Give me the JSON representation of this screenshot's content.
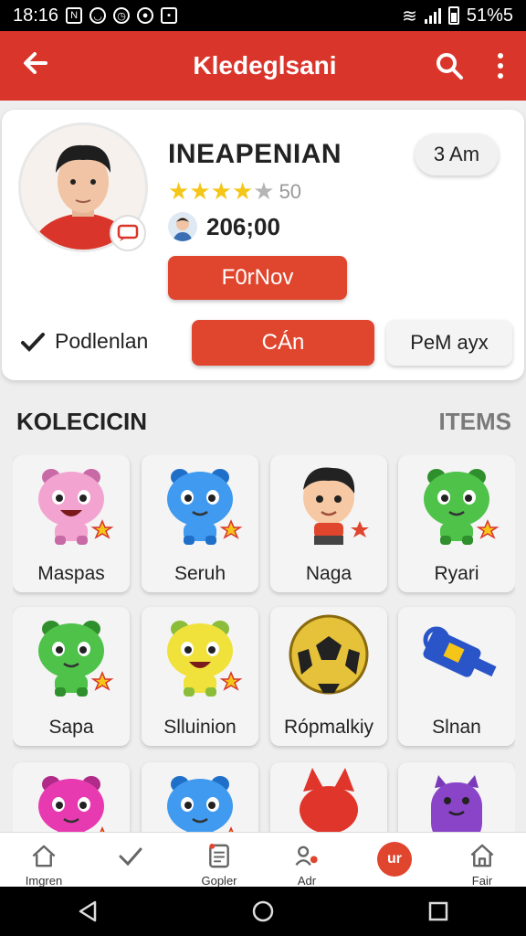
{
  "status_bar": {
    "time": "18:16",
    "battery": "51%5"
  },
  "app_bar": {
    "title": "Kledeglsani"
  },
  "profile": {
    "name": "INEAPENIAN",
    "rating": 4,
    "rating_max": 5,
    "score": "50",
    "coins": "206;00",
    "time_chip": "3 Am",
    "follow_label": "F0rNov",
    "check_label": "Podlenlan",
    "chat_label": "CÁn",
    "message_label": "PeM ayx"
  },
  "collection": {
    "title": "KOLECICIN",
    "more": "ITEMS",
    "items": [
      {
        "label": "Maspas",
        "art": "pink-bear"
      },
      {
        "label": "Seruh",
        "art": "blue-bear"
      },
      {
        "label": "Naga",
        "art": "boy"
      },
      {
        "label": "Ryari",
        "art": "green-bear"
      },
      {
        "label": "Sapa",
        "art": "green-bear"
      },
      {
        "label": "Slluinion",
        "art": "yellow-bear"
      },
      {
        "label": "Rópmalkiy",
        "art": "ball"
      },
      {
        "label": "Slnan",
        "art": "whistle"
      },
      {
        "label": "",
        "art": "magenta-bear"
      },
      {
        "label": "",
        "art": "blue-bear"
      },
      {
        "label": "",
        "art": "red-fox"
      },
      {
        "label": "",
        "art": "purple-blob"
      }
    ]
  },
  "bottom_nav": [
    {
      "label": "Imgren",
      "icon": "home-icon"
    },
    {
      "label": "",
      "icon": "check-icon"
    },
    {
      "label": "Gopler",
      "icon": "list-icon"
    },
    {
      "label": "Adr",
      "icon": "people-icon"
    },
    {
      "label": "ur",
      "icon": "badge-icon"
    },
    {
      "label": "Fair",
      "icon": "house-icon"
    }
  ],
  "colors": {
    "brand": "#d9352b",
    "accent": "#e0452e",
    "star": "#f5c518"
  }
}
